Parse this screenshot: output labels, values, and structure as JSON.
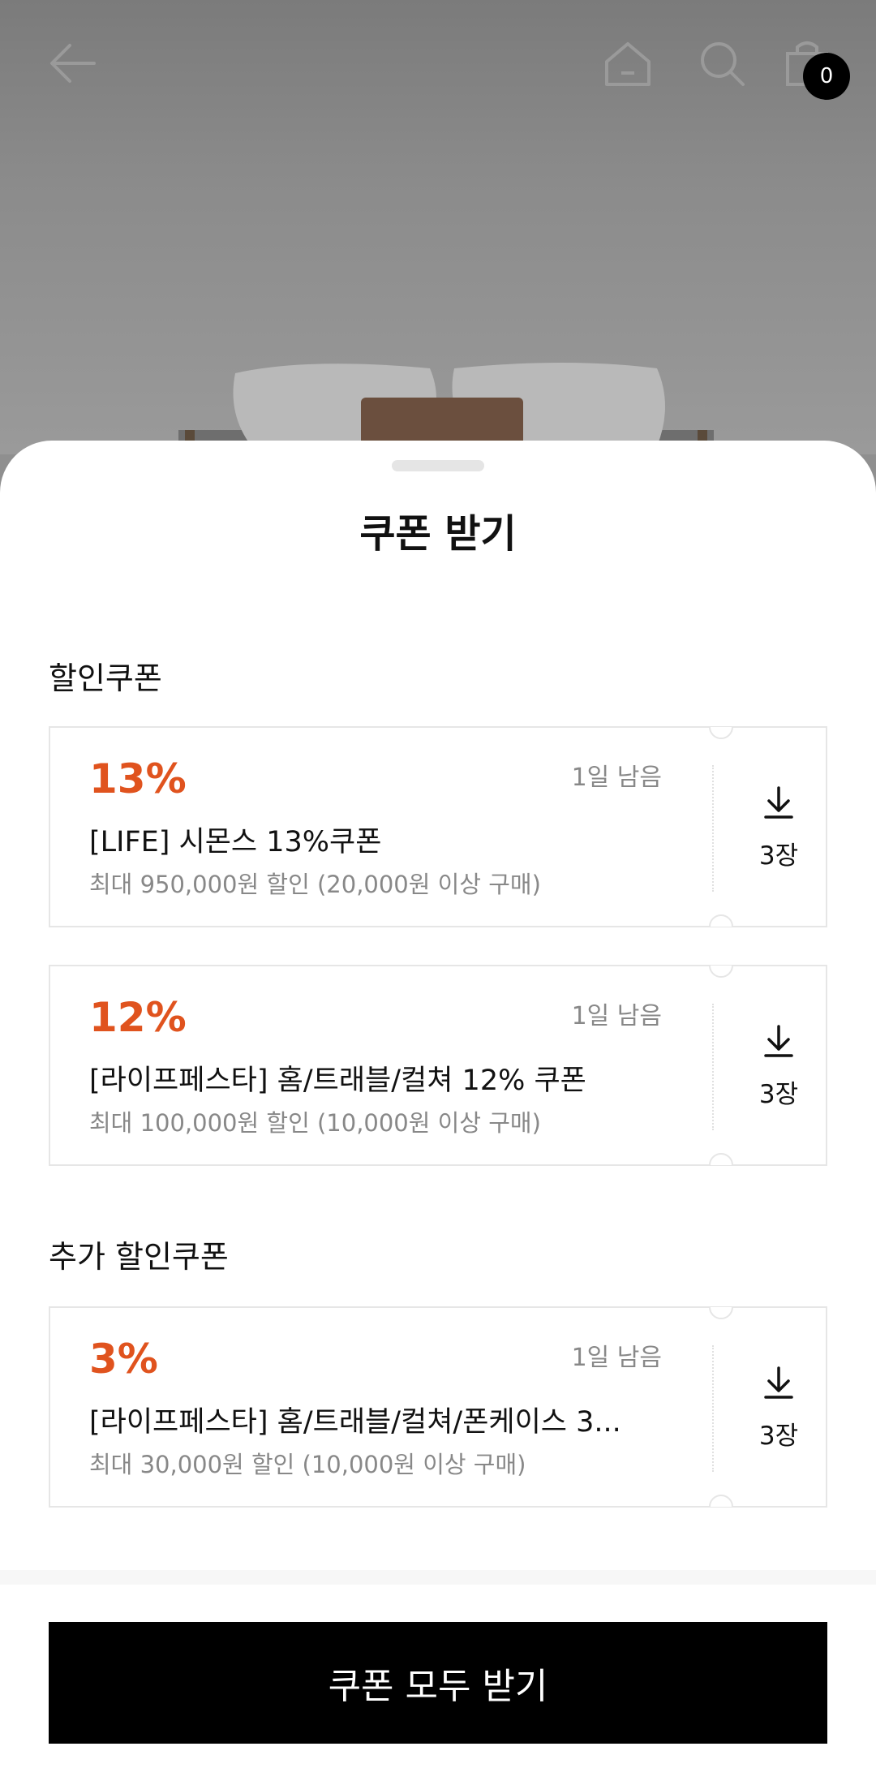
{
  "header": {
    "back_icon": "arrow-left-icon",
    "home_icon": "home-icon",
    "search_icon": "search-icon",
    "cart_icon": "shopping-bag-icon",
    "cart_count": "0"
  },
  "sheet": {
    "title": "쿠폰 받기",
    "sections": [
      {
        "title": "할인쿠폰",
        "coupons": [
          {
            "rate": "13%",
            "remaining": "1일 남음",
            "name": "[LIFE] 시몬스 13%쿠폰",
            "desc": "최대 950,000원 할인 (20,000원 이상 구매)",
            "count": "3장"
          },
          {
            "rate": "12%",
            "remaining": "1일 남음",
            "name": "[라이프페스타] 홈/트래블/컬쳐 12% 쿠폰",
            "desc": "최대 100,000원 할인 (10,000원 이상 구매)",
            "count": "3장"
          }
        ]
      },
      {
        "title": "추가 할인쿠폰",
        "coupons": [
          {
            "rate": "3%",
            "remaining": "1일 남음",
            "name": "[라이프페스타] 홈/트래블/컬쳐/폰케이스 3...",
            "desc": "최대 30,000원 할인 (10,000원 이상 구매)",
            "count": "3장"
          }
        ]
      }
    ],
    "cta_label": "쿠폰 모두 받기"
  },
  "colors": {
    "accent": "#e0531e",
    "cta_bg": "#000000"
  }
}
